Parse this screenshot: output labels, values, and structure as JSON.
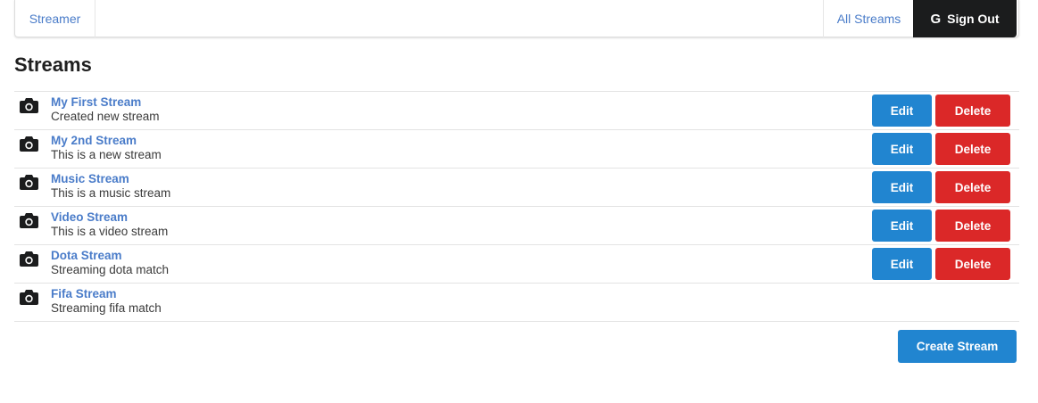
{
  "nav": {
    "brand": "Streamer",
    "all_streams": "All Streams",
    "sign_out": "Sign Out",
    "sign_out_icon": "google-icon"
  },
  "page": {
    "title": "Streams"
  },
  "streams": [
    {
      "title": "My First Stream",
      "description": "Created new stream",
      "edit_label": "Edit",
      "delete_label": "Delete"
    },
    {
      "title": "My 2nd Stream",
      "description": "This is a new stream",
      "edit_label": "Edit",
      "delete_label": "Delete"
    },
    {
      "title": "Music Stream",
      "description": "This is a music stream",
      "edit_label": "Edit",
      "delete_label": "Delete"
    },
    {
      "title": "Video Stream",
      "description": "This is a video stream",
      "edit_label": "Edit",
      "delete_label": "Delete"
    },
    {
      "title": "Dota Stream",
      "description": "Streaming dota match",
      "edit_label": "Edit",
      "delete_label": "Delete"
    },
    {
      "title": "Fifa Stream",
      "description": "Streaming fifa match"
    }
  ],
  "actions": {
    "create_label": "Create Stream"
  },
  "colors": {
    "primary": "#2185d0",
    "danger": "#db2828",
    "dark": "#1b1c1d",
    "link": "#4a7cc9"
  }
}
